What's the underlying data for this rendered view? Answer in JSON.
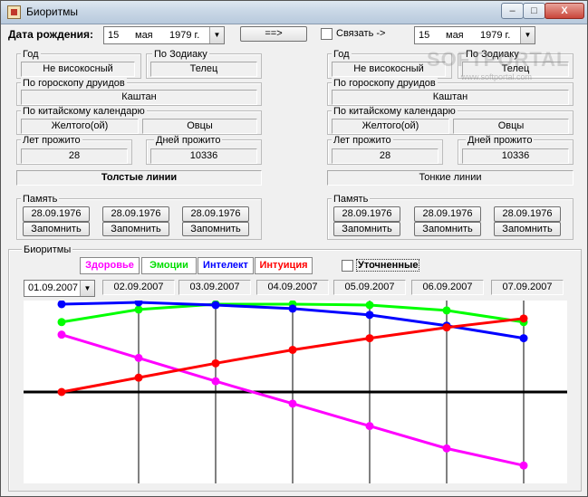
{
  "window": {
    "title": "Биоритмы",
    "min": "–",
    "max": "□",
    "close": "X"
  },
  "top": {
    "birth_label": "Дата рождения:",
    "date1": {
      "day": "15",
      "month": "мая",
      "year": "1979 г."
    },
    "go_button": "==>",
    "link_label": "Связать ->",
    "date2": {
      "day": "15",
      "month": "мая",
      "year": "1979 г."
    }
  },
  "left": {
    "year_label": "Год",
    "year_value": "Не високосный",
    "zodiac_label": "По Зодиаку",
    "zodiac_value": "Телец",
    "druid_label": "По гороскопу друидов",
    "druid_value": "Каштан",
    "chinese_label": "По китайскому календарю",
    "chinese_value1": "Желтого(ой)",
    "chinese_value2": "Овцы",
    "years_label": "Лет прожито",
    "years_value": "28",
    "days_label": "Дней прожито",
    "days_value": "10336",
    "lines_label": "Толстые линии",
    "memory_label": "Память",
    "memory": [
      {
        "date": "28.09.1976",
        "btn": "Запомнить"
      },
      {
        "date": "28.09.1976",
        "btn": "Запомнить"
      },
      {
        "date": "28.09.1976",
        "btn": "Запомнить"
      }
    ]
  },
  "right": {
    "year_label": "Год",
    "year_value": "Не високосный",
    "zodiac_label": "По Зодиаку",
    "zodiac_value": "Телец",
    "druid_label": "По гороскопу друидов",
    "druid_value": "Каштан",
    "chinese_label": "По китайскому календарю",
    "chinese_value1": "Желтого(ой)",
    "chinese_value2": "Овцы",
    "years_label": "Лет прожито",
    "years_value": "28",
    "days_label": "Дней прожито",
    "days_value": "10336",
    "lines_label": "Тонкие линии",
    "memory_label": "Память",
    "memory": [
      {
        "date": "28.09.1976",
        "btn": "Запомнить"
      },
      {
        "date": "28.09.1976",
        "btn": "Запомнить"
      },
      {
        "date": "28.09.1976",
        "btn": "Запомнить"
      }
    ]
  },
  "biorhythms": {
    "group_label": "Биоритмы",
    "legend": [
      {
        "label": "Здоровье",
        "color": "#ff00ff"
      },
      {
        "label": "Эмоции",
        "color": "#00ff00"
      },
      {
        "label": "Интелект",
        "color": "#0000ff"
      },
      {
        "label": "Интуиция",
        "color": "#ff0000"
      }
    ],
    "refined_label": "Уточненные",
    "start_date": "01.09.2007",
    "dates": [
      "02.09.2007",
      "03.09.2007",
      "04.09.2007",
      "05.09.2007",
      "06.09.2007",
      "07.09.2007"
    ]
  },
  "watermark": {
    "logo": "SOFTPORTAL",
    "url": "www.softportal.com"
  },
  "chart_data": {
    "type": "line",
    "categories": [
      "01.09.2007",
      "02.09.2007",
      "03.09.2007",
      "04.09.2007",
      "05.09.2007",
      "06.09.2007",
      "07.09.2007"
    ],
    "series": [
      {
        "name": "Здоровье",
        "color": "#ff00ff",
        "values": [
          0.64,
          0.38,
          0.12,
          -0.13,
          -0.38,
          -0.63,
          -0.82
        ]
      },
      {
        "name": "Эмоции",
        "color": "#00ff00",
        "values": [
          0.78,
          0.92,
          0.98,
          0.98,
          0.97,
          0.91,
          0.78
        ]
      },
      {
        "name": "Интелект",
        "color": "#0000ff",
        "values": [
          0.98,
          1.0,
          0.97,
          0.93,
          0.86,
          0.74,
          0.6
        ]
      },
      {
        "name": "Интуиция",
        "color": "#ff0000",
        "values": [
          0.0,
          0.16,
          0.32,
          0.47,
          0.6,
          0.72,
          0.82
        ]
      }
    ],
    "ylim": [
      -1,
      1
    ],
    "grid": true
  }
}
